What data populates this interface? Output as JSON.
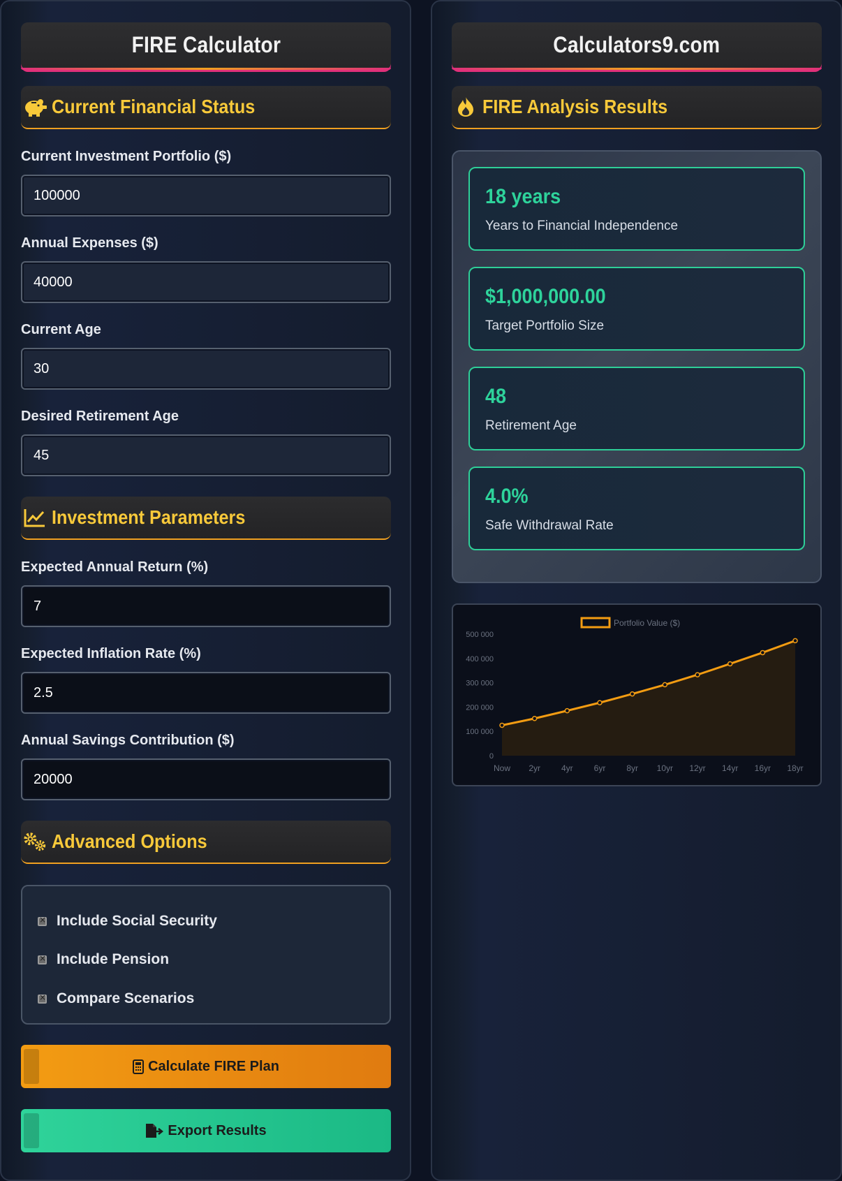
{
  "left": {
    "title": "FIRE Calculator",
    "sections": {
      "status": "Current Financial Status",
      "invest": "Investment Parameters",
      "advanced": "Advanced Options"
    },
    "fields": [
      {
        "label": "Current Investment Portfolio ($)",
        "value": "100000"
      },
      {
        "label": "Annual Expenses ($)",
        "value": "40000"
      },
      {
        "label": "Current Age",
        "value": "30"
      },
      {
        "label": "Desired Retirement Age",
        "value": "45"
      },
      {
        "label": "Expected Annual Return (%)",
        "value": "7"
      },
      {
        "label": "Expected Inflation Rate (%)",
        "value": "2.5"
      },
      {
        "label": "Annual Savings Contribution ($)",
        "value": "20000"
      }
    ],
    "options": [
      "Include Social Security",
      "Include Pension",
      "Compare Scenarios"
    ],
    "buttons": {
      "calculate": "Calculate FIRE Plan",
      "export": "Export Results"
    }
  },
  "right": {
    "title": "Calculators9.com",
    "section": "FIRE Analysis Results",
    "results": [
      {
        "value": "18 years",
        "label": "Years to Financial Independence"
      },
      {
        "value": "$1,000,000.00",
        "label": "Target Portfolio Size"
      },
      {
        "value": "48",
        "label": "Retirement Age"
      },
      {
        "value": "4.0%",
        "label": "Safe Withdrawal Rate"
      }
    ]
  },
  "colors": {
    "accent": "#f8c93a",
    "orange": "#f39c12",
    "green": "#2ed39b"
  },
  "chart_data": {
    "type": "line",
    "title": "",
    "legend": "Portfolio Value ($)",
    "legend_position": "top",
    "categories": [
      "Now",
      "2yr",
      "4yr",
      "6yr",
      "8yr",
      "10yr",
      "12yr",
      "14yr",
      "16yr",
      "18yr"
    ],
    "series": [
      {
        "name": "Portfolio Value ($)",
        "values": [
          125000,
          153000,
          185000,
          218000,
          254000,
          292000,
          333000,
          378000,
          424000,
          473000
        ]
      }
    ],
    "y_ticks": [
      "0",
      "100 000",
      "200 000",
      "300 000",
      "400 000",
      "500 000"
    ],
    "ylim": [
      0,
      500000
    ],
    "grid": false,
    "fill": true
  }
}
